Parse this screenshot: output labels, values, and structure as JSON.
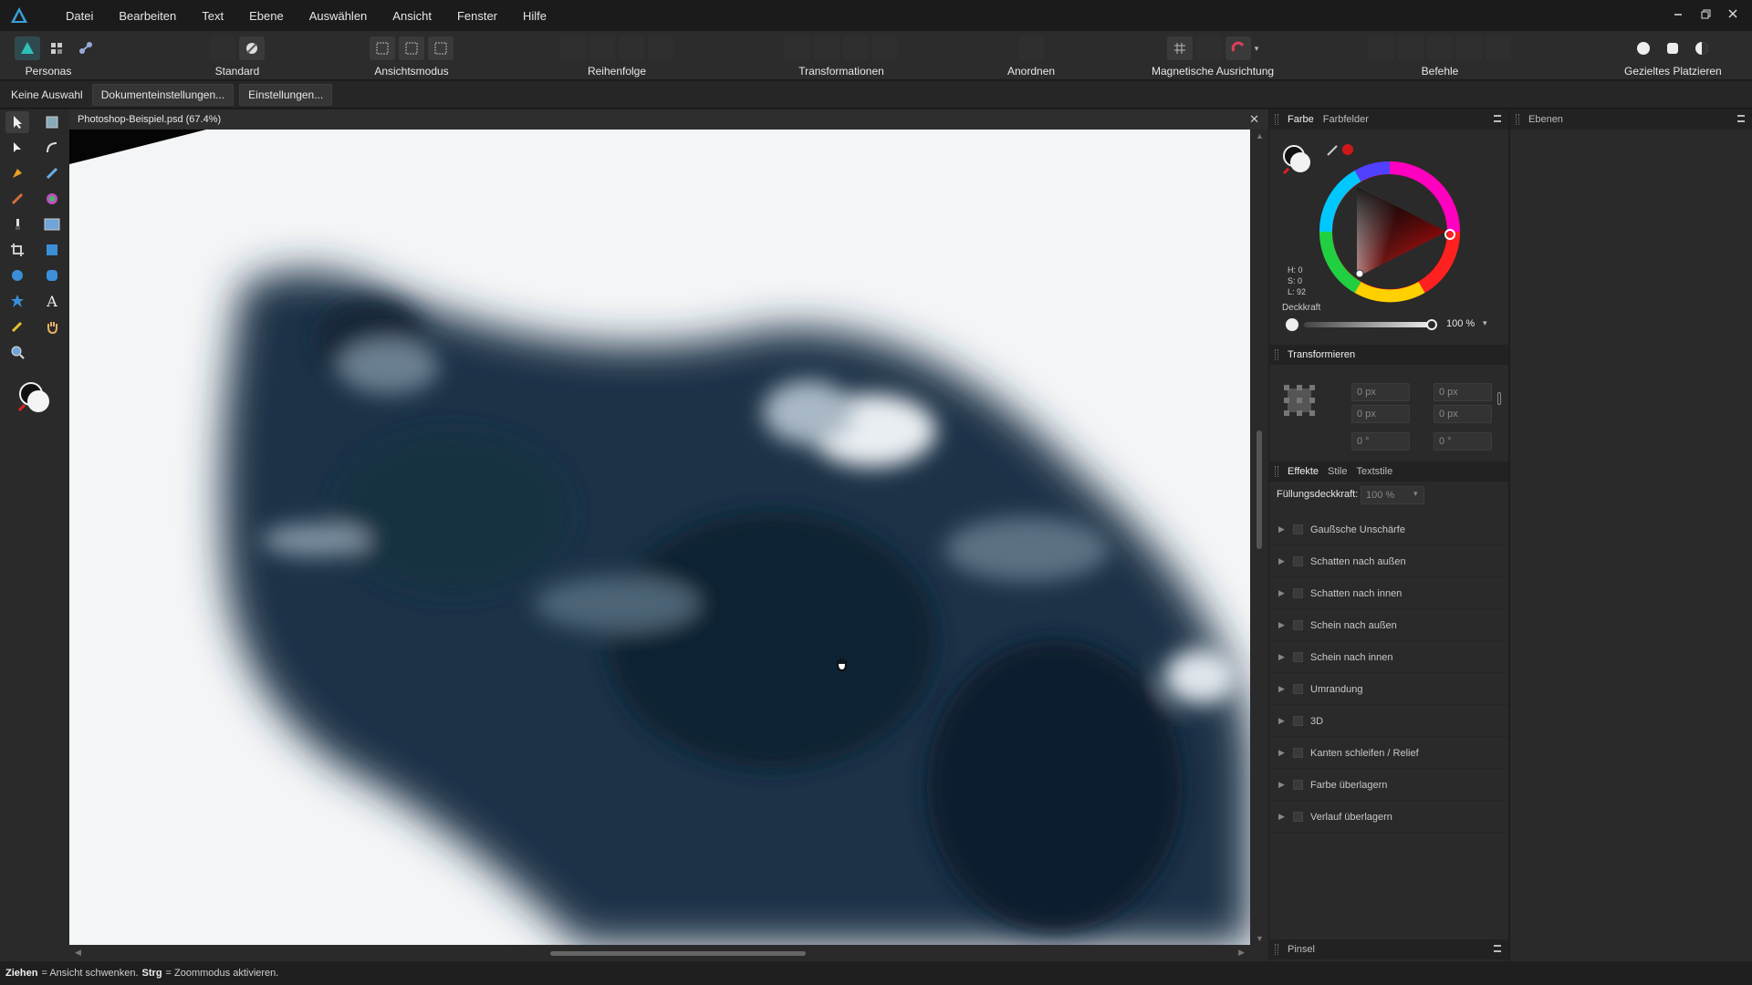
{
  "menu": {
    "items": [
      "Datei",
      "Bearbeiten",
      "Text",
      "Ebene",
      "Auswählen",
      "Ansicht",
      "Fenster",
      "Hilfe"
    ]
  },
  "toolbar": {
    "personas_label": "Personas",
    "standard_label": "Standard",
    "ansichtsmodus_label": "Ansichtsmodus",
    "reihenfolge_label": "Reihenfolge",
    "transformationen_label": "Transformationen",
    "anordnen_label": "Anordnen",
    "magnetische_label": "Magnetische Ausrichtung",
    "befehle_label": "Befehle",
    "gezieltes_label": "Gezieltes Platzieren"
  },
  "context": {
    "selection": "Keine Auswahl",
    "doc_settings": "Dokumenteinstellungen...",
    "settings": "Einstellungen..."
  },
  "document": {
    "title": "Photoshop-Beispiel.psd (67.4%)"
  },
  "color_panel": {
    "tab_color": "Farbe",
    "tab_swatches": "Farbfelder",
    "h": "H: 0",
    "s": "S: 0",
    "l": "L: 92",
    "opacity_label": "Deckkraft",
    "opacity_value": "100 %",
    "accent": "#d01818"
  },
  "layers_panel": {
    "title": "Ebenen"
  },
  "transform_panel": {
    "title": "Transformieren",
    "x": "0 px",
    "y": "0 px",
    "w": "0 px",
    "h": "0 px",
    "r": "0 °",
    "s": "0 °"
  },
  "effects_panel": {
    "tab_effects": "Effekte",
    "tab_styles": "Stile",
    "tab_textstyles": "Textstile",
    "fill_opacity_label": "Füllungsdeckkraft:",
    "fill_opacity_value": "100 %",
    "effects": [
      "Gaußsche Unschärfe",
      "Schatten nach außen",
      "Schatten nach innen",
      "Schein nach außen",
      "Schein nach innen",
      "Umrandung",
      "3D",
      "Kanten schleifen / Relief",
      "Farbe überlagern",
      "Verlauf überlagern"
    ]
  },
  "brush_panel": {
    "title": "Pinsel"
  },
  "status": {
    "drag_key": "Ziehen",
    "drag_text": "= Ansicht schwenken.",
    "ctrl_key": "Strg",
    "ctrl_text": "= Zoommodus aktivieren."
  }
}
